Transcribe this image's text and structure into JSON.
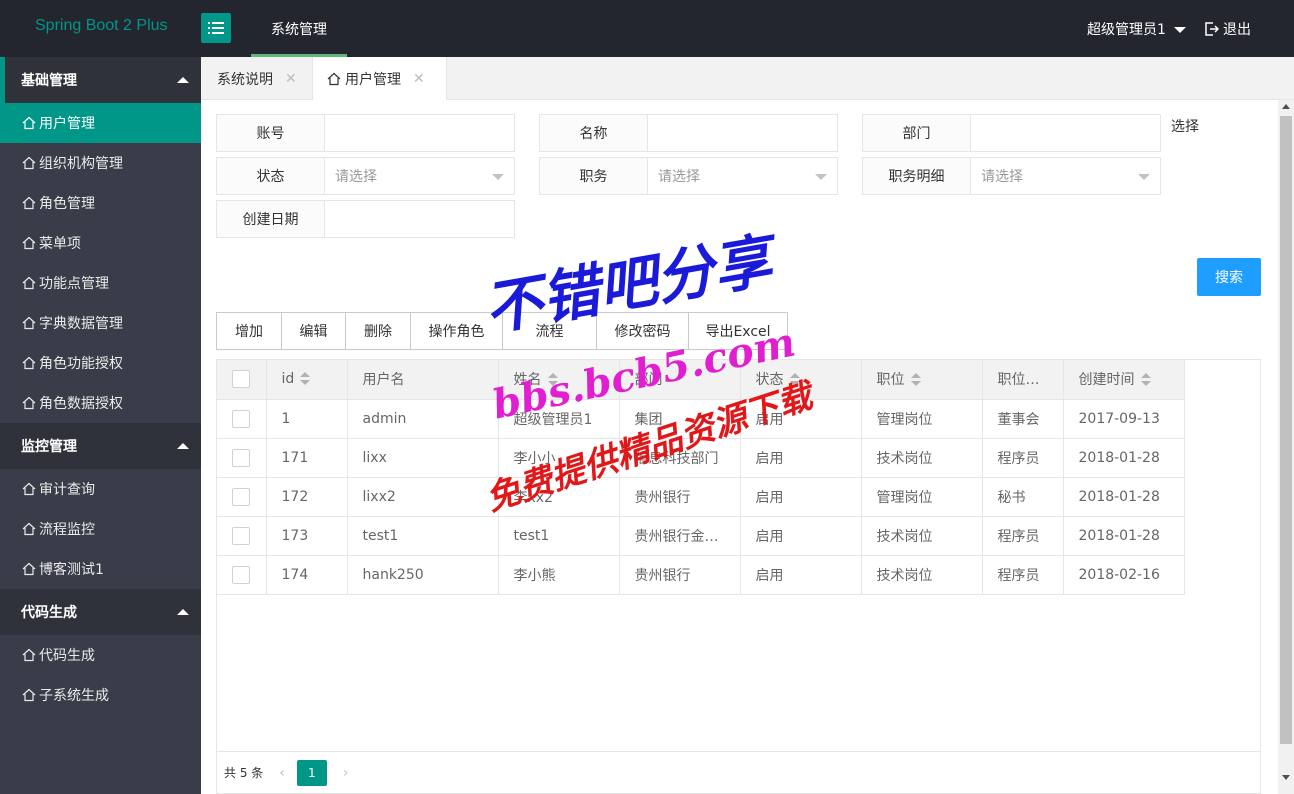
{
  "header": {
    "logo": "Spring Boot 2 Plus",
    "nav_item": "系统管理",
    "user": "超级管理员1",
    "logout": "退出"
  },
  "sidebar": {
    "groups": [
      {
        "title": "基础管理",
        "items": [
          "用户管理",
          "组织机构管理",
          "角色管理",
          "菜单项",
          "功能点管理",
          "字典数据管理",
          "角色功能授权",
          "角色数据授权"
        ]
      },
      {
        "title": "监控管理",
        "items": [
          "审计查询",
          "流程监控",
          "博客测试1"
        ]
      },
      {
        "title": "代码生成",
        "items": [
          "代码生成",
          "子系统生成"
        ]
      }
    ]
  },
  "tabs": [
    {
      "label": "系统说明"
    },
    {
      "label": "用户管理"
    }
  ],
  "filters": {
    "account_label": "账号",
    "name_label": "名称",
    "dept_label": "部门",
    "choose": "选择",
    "status_label": "状态",
    "status_placeholder": "请选择",
    "job_label": "职务",
    "job_placeholder": "请选择",
    "job_detail_label": "职务明细",
    "job_detail_placeholder": "请选择",
    "created_label": "创建日期",
    "search_button": "搜索"
  },
  "toolbar": [
    "增加",
    "编辑",
    "删除",
    "操作角色",
    "流程",
    "修改密码",
    "导出Excel"
  ],
  "table": {
    "columns": [
      "id",
      "用户名",
      "姓名",
      "部门",
      "状态",
      "职位",
      "职位…",
      "创建时间"
    ],
    "rows": [
      [
        "1",
        "admin",
        "超级管理员1",
        "集团",
        "启用",
        "管理岗位",
        "董事会",
        "2017-09-13"
      ],
      [
        "171",
        "lixx",
        "李小小",
        "信息科技部门",
        "启用",
        "技术岗位",
        "程序员",
        "2018-01-28"
      ],
      [
        "172",
        "lixx2",
        "李xx2",
        "贵州银行",
        "启用",
        "管理岗位",
        "秘书",
        "2018-01-28"
      ],
      [
        "173",
        "test1",
        "test1",
        "贵州银行金…",
        "启用",
        "技术岗位",
        "程序员",
        "2018-01-28"
      ],
      [
        "174",
        "hank250",
        "李小熊",
        "贵州银行",
        "启用",
        "技术岗位",
        "程序员",
        "2018-02-16"
      ]
    ]
  },
  "pager": {
    "total": "共 5 条",
    "current": "1"
  },
  "watermark": {
    "line1": "不错吧分享",
    "line2": "bbs.bcb5.com",
    "line3": "免费提供精品资源下载"
  },
  "colors": {
    "header_bg": "#23262e",
    "sidebar_bg": "#393d49",
    "accent": "#009688",
    "search_btn": "#1e9fff"
  }
}
